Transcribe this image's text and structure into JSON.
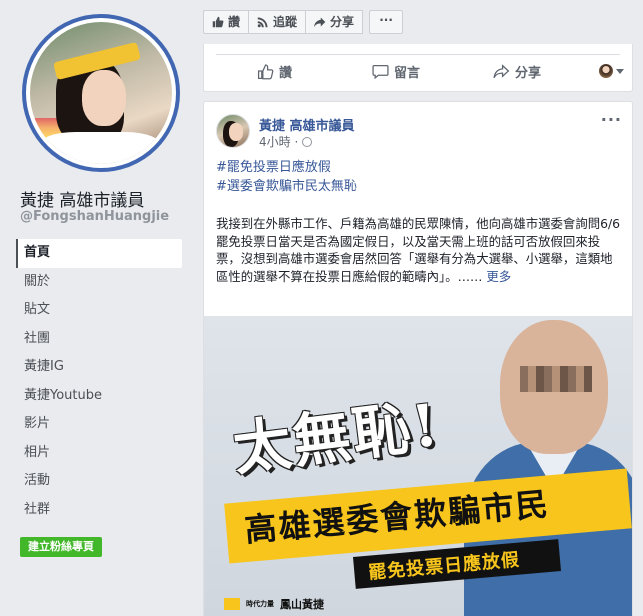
{
  "profile": {
    "name": "黃捷 高雄市議員",
    "handle": "@FongshanHuangjie"
  },
  "nav": {
    "items": [
      {
        "label": "首頁"
      },
      {
        "label": "關於"
      },
      {
        "label": "貼文"
      },
      {
        "label": "社團"
      },
      {
        "label": "黃捷IG"
      },
      {
        "label": "黃捷Youtube"
      },
      {
        "label": "影片"
      },
      {
        "label": "相片"
      },
      {
        "label": "活動"
      },
      {
        "label": "社群"
      }
    ],
    "create_fan_page": "建立粉絲專頁"
  },
  "page_actions": {
    "like": "讚",
    "follow": "追蹤",
    "share": "分享",
    "more": "···"
  },
  "prev_post_actions": {
    "like": "讚",
    "comment": "留言",
    "share": "分享"
  },
  "post": {
    "author": "黃捷 高雄市議員",
    "time": "4小時 ·",
    "more": "···",
    "hashtags": [
      "#罷免投票日應放假",
      "#選委會欺騙市民太無恥"
    ],
    "body": "我接到在外縣市工作、戶籍為高雄的民眾陳情，他向高雄市選委會詢問6/6罷免投票日當天是否為國定假日，以及當天需上班的話可否放假回來投票，沒想到高雄市選委會居然回答「選舉有分為大選舉、小選舉，這類地區性的選舉不算在投票日應給假的範疇內」。……",
    "see_more": "更多",
    "image": {
      "headline": "太無恥!",
      "band_text": "高雄選委會欺騙市民",
      "sub_text": "罷免投票日應放假",
      "logo_text": "時代力量",
      "logo_text2": "鳳山黃捷"
    }
  },
  "colors": {
    "fb_blue": "#4267b2",
    "link_blue": "#385898",
    "green_button": "#42b72a",
    "poster_yellow": "#f7c51c"
  }
}
